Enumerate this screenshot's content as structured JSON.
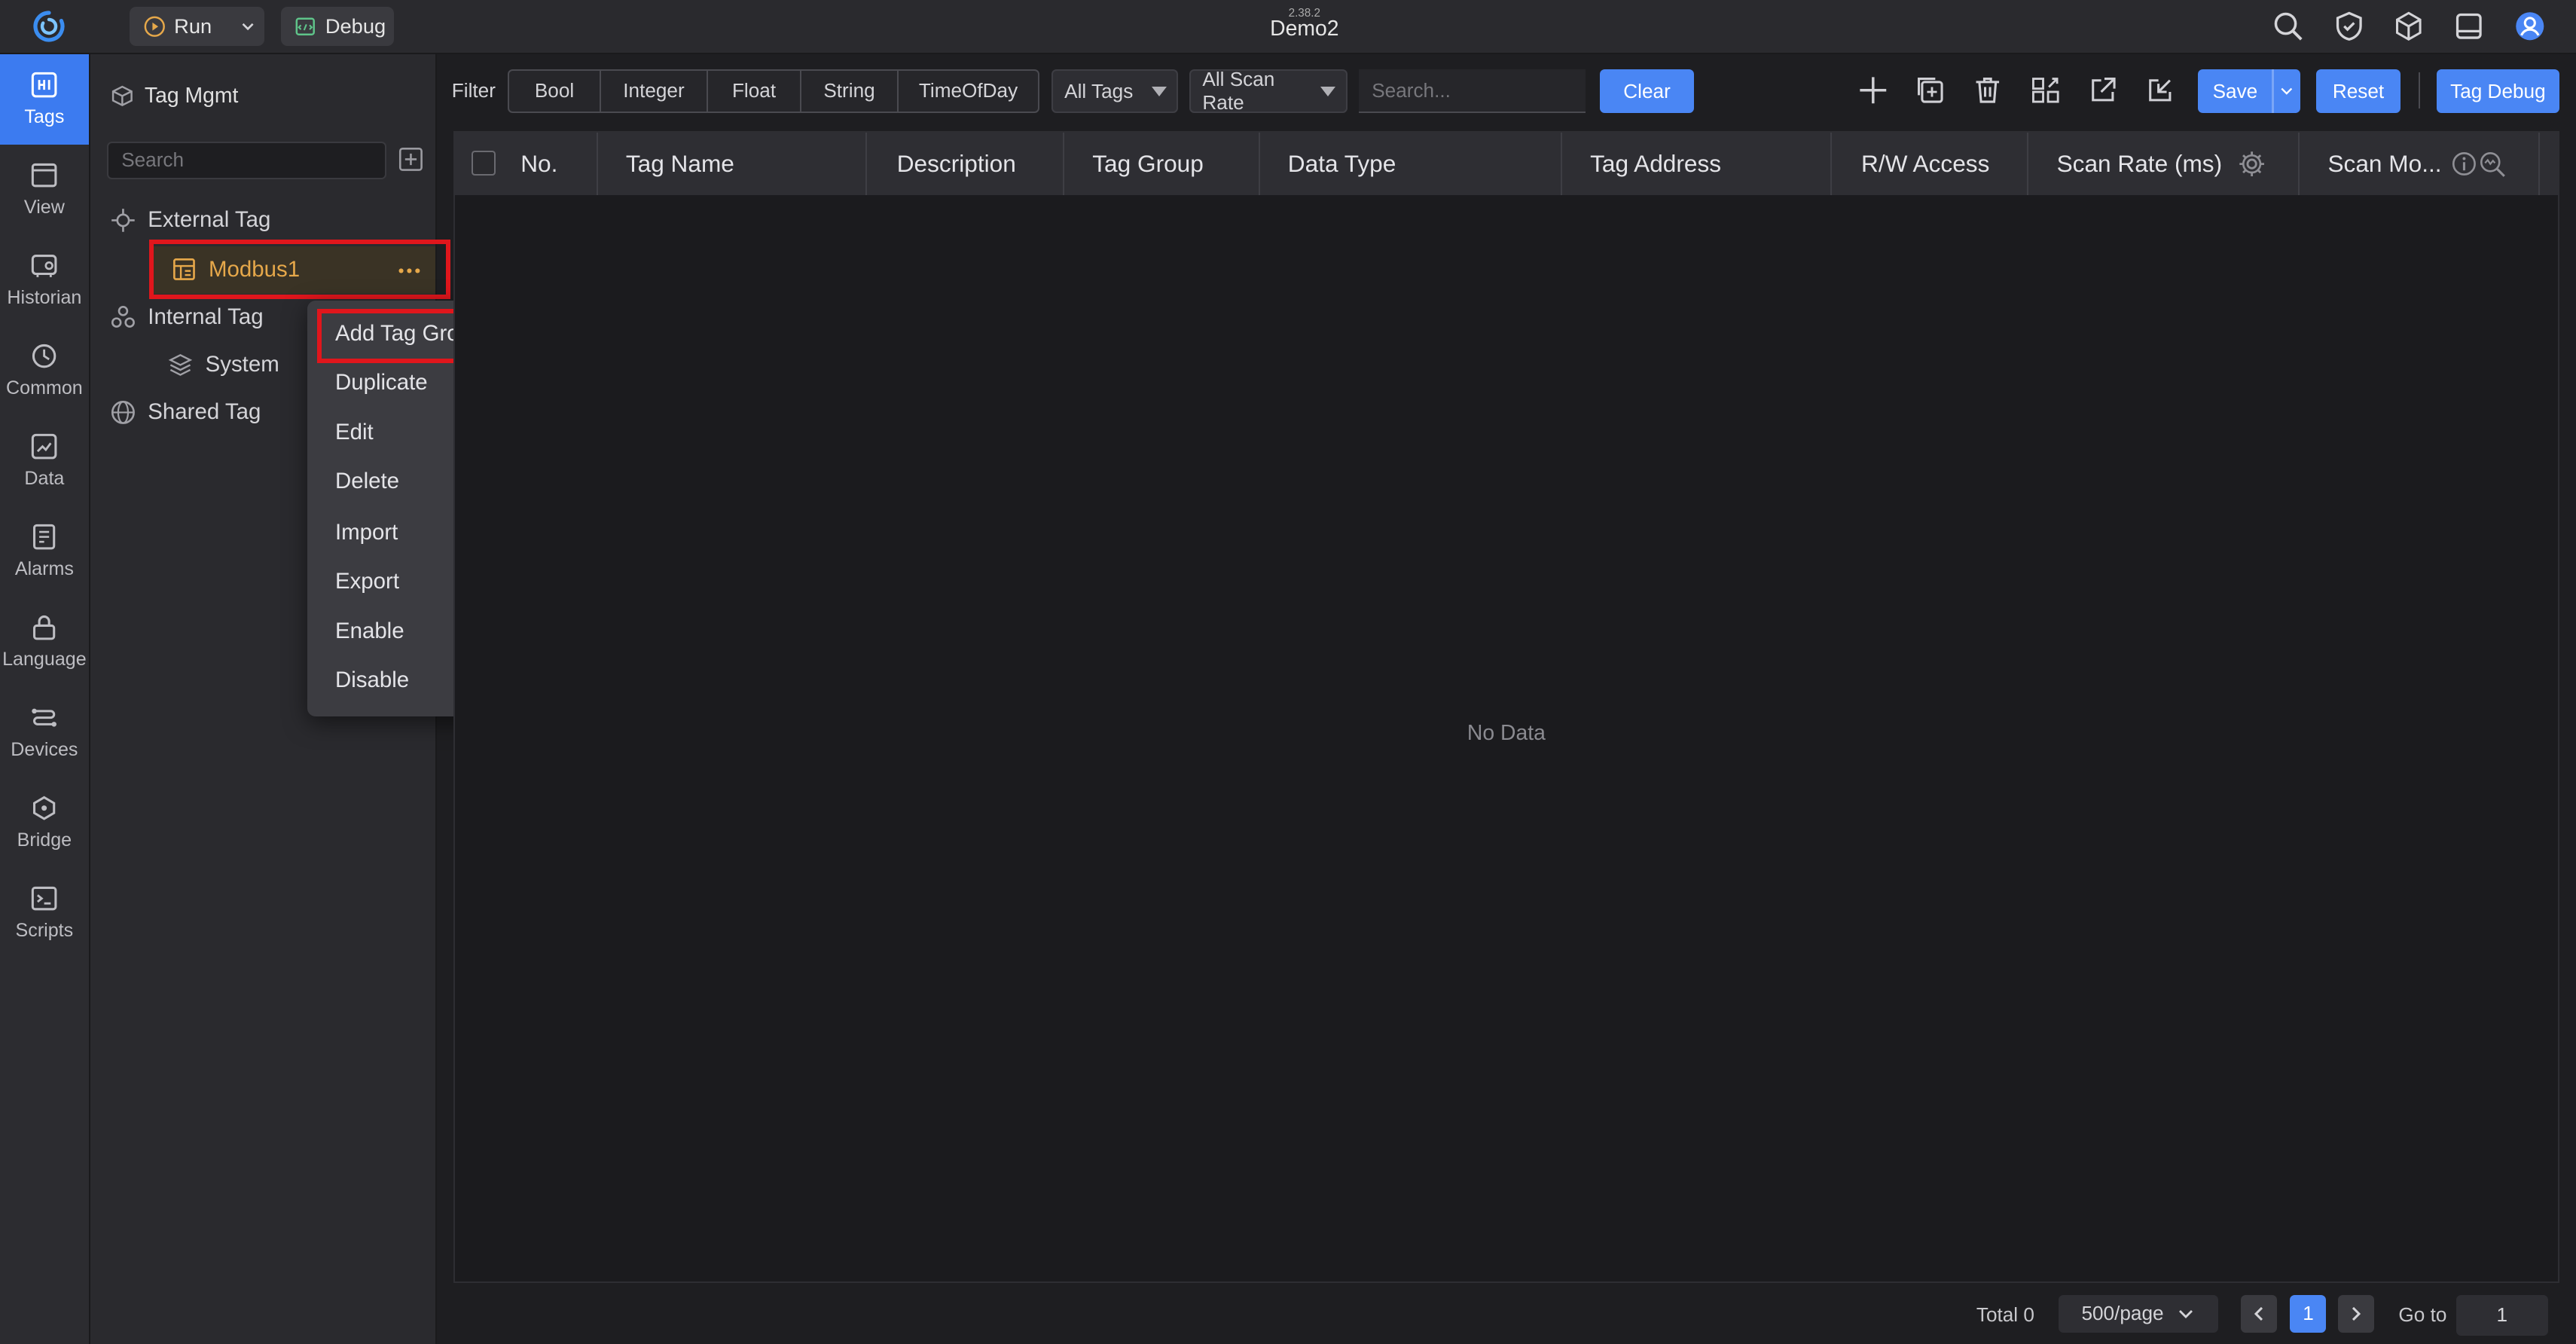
{
  "app": {
    "version": "2.38.2",
    "project_name": "Demo2"
  },
  "topbar": {
    "run_label": "Run",
    "debug_label": "Debug"
  },
  "leftnav": {
    "items": [
      {
        "label": "Tags",
        "icon": "tags-icon",
        "active": true
      },
      {
        "label": "View",
        "icon": "view-icon"
      },
      {
        "label": "Historian",
        "icon": "historian-icon"
      },
      {
        "label": "Common",
        "icon": "common-icon"
      },
      {
        "label": "Data",
        "icon": "data-icon"
      },
      {
        "label": "Alarms",
        "icon": "alarms-icon"
      },
      {
        "label": "Language",
        "icon": "language-icon"
      },
      {
        "label": "Devices",
        "icon": "devices-icon"
      },
      {
        "label": "Bridge",
        "icon": "bridge-icon"
      },
      {
        "label": "Scripts",
        "icon": "scripts-icon"
      }
    ]
  },
  "tagpanel": {
    "title": "Tag Mgmt",
    "search_placeholder": "Search",
    "tree": {
      "external": "External Tag",
      "modbus": "Modbus1",
      "internal": "Internal Tag",
      "system": "System",
      "shared": "Shared Tag"
    }
  },
  "context_menu": {
    "items": [
      "Add Tag Group",
      "Duplicate",
      "Edit",
      "Delete",
      "Import",
      "Export",
      "Enable",
      "Disable"
    ],
    "highlighted": "Add Tag Group"
  },
  "toolbar": {
    "filter_label": "Filter",
    "filters": [
      "Bool",
      "Integer",
      "Float",
      "String",
      "TimeOfDay"
    ],
    "tags_dropdown": "All Tags",
    "scan_rate_dropdown": "All Scan Rate",
    "search_placeholder": "Search...",
    "clear_label": "Clear",
    "save_label": "Save",
    "reset_label": "Reset",
    "tag_debug_label": "Tag Debug"
  },
  "table": {
    "columns": [
      "No.",
      "Tag Name",
      "Description",
      "Tag Group",
      "Data Type",
      "Tag Address",
      "R/W Access",
      "Scan Rate (ms)",
      "Scan Mo..."
    ],
    "empty_text": "No Data"
  },
  "pagination": {
    "total": "Total 0",
    "page_size": "500/page",
    "current_page": "1",
    "goto_label": "Go to",
    "goto_value": "1"
  },
  "colors": {
    "accent": "#4a86f4",
    "selected_item_text": "#e6a84a",
    "highlight_border": "#e0161c",
    "background": "#1e1e21"
  }
}
